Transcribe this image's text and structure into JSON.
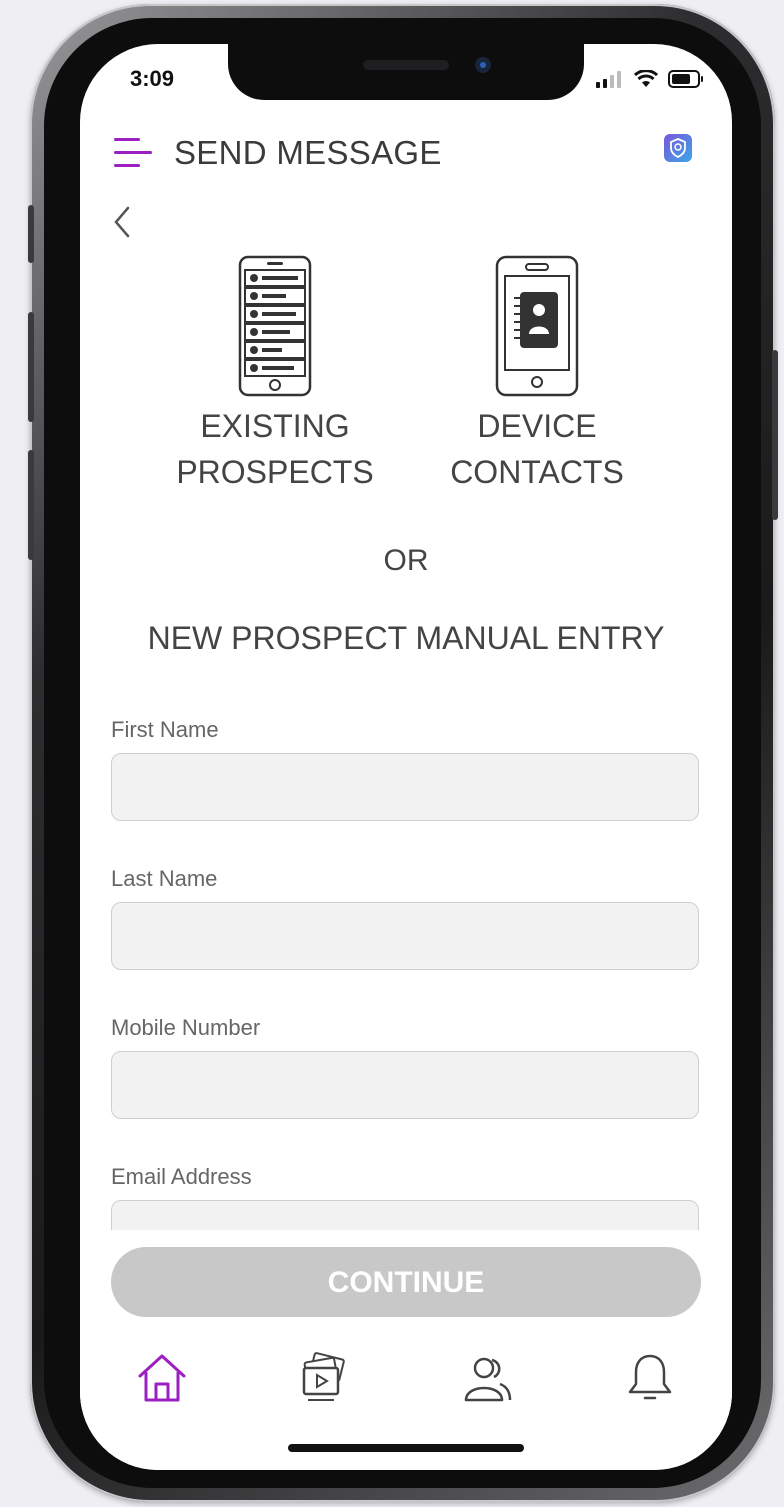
{
  "status": {
    "time": "3:09"
  },
  "header": {
    "title": "SEND MESSAGE"
  },
  "options": [
    {
      "line1": "EXISTING",
      "line2": "PROSPECTS"
    },
    {
      "line1": "DEVICE",
      "line2": "CONTACTS"
    }
  ],
  "or_text": "OR",
  "manual_title": "NEW PROSPECT MANUAL ENTRY",
  "form": {
    "first_name_label": "First Name",
    "first_name_value": "",
    "last_name_label": "Last Name",
    "last_name_value": "",
    "mobile_label": "Mobile Number",
    "mobile_value": "",
    "email_label": "Email Address",
    "email_value": ""
  },
  "continue_label": "CONTINUE",
  "colors": {
    "accent": "#9b1fc1",
    "button_disabled": "#c8c8c8",
    "field_bg": "#f2f2f2"
  },
  "nav": [
    {
      "name": "home",
      "icon": "home-icon",
      "active": true
    },
    {
      "name": "media",
      "icon": "media-icon",
      "active": false
    },
    {
      "name": "contacts",
      "icon": "people-icon",
      "active": false
    },
    {
      "name": "notifications",
      "icon": "bell-icon",
      "active": false
    }
  ]
}
